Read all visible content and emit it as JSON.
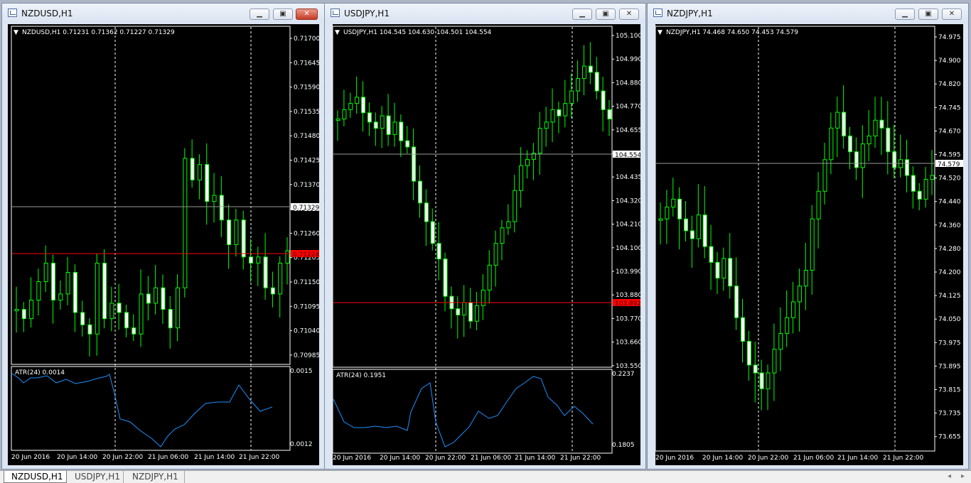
{
  "windows": [
    {
      "title": "NZDUSD,H1",
      "info": "NZDUSD,H1  0.71231 0.71362 0.71227 0.71329",
      "price_labels": [
        "0.71700",
        "0.71645",
        "0.71590",
        "0.71535",
        "0.71480",
        "0.71425",
        "0.71370",
        "0.71315",
        "0.71260",
        "0.71205",
        "0.71150",
        "0.71095",
        "0.71040",
        "0.70985"
      ],
      "current_price": "0.71329",
      "bid_line": "0.71224",
      "indicator": "ATR(24) 0.0014",
      "ind_top": "0.0015",
      "ind_bottom": "0.0012",
      "time_labels": [
        "20 Jun 2016",
        "20 Jun 14:00",
        "20 Jun 22:00",
        "21 Jun 06:00",
        "21 Jun 14:00",
        "21 Jun 22:00"
      ]
    },
    {
      "title": "USDJPY,H1",
      "info": "USDJPY,H1  104.545 104.630 104.501 104.554",
      "price_labels": [
        "105.100",
        "104.990",
        "104.880",
        "104.770",
        "104.655",
        "104.545",
        "104.435",
        "104.320",
        "104.210",
        "104.100",
        "103.990",
        "103.880",
        "103.770",
        "103.660",
        "103.550"
      ],
      "current_price": "104.554",
      "bid_line": "103.892",
      "indicator": "ATR(24) 0.1951",
      "ind_top": "0.2237",
      "ind_bottom": "0.1805",
      "time_labels": [
        "20 Jun 2016",
        "20 Jun 14:00",
        "20 Jun 22:00",
        "21 Jun 06:00",
        "21 Jun 14:00",
        "21 Jun 22:00"
      ]
    },
    {
      "title": "NZDJPY,H1",
      "info": "NZDJPY,H1  74.468 74.650 74.453 74.579",
      "price_labels": [
        "74.975",
        "74.900",
        "74.820",
        "74.745",
        "74.670",
        "74.595",
        "74.520",
        "74.440",
        "74.360",
        "74.280",
        "74.200",
        "74.125",
        "74.050",
        "73.975",
        "73.895",
        "73.815",
        "73.735",
        "73.655"
      ],
      "current_price": "74.579",
      "time_labels": [
        "20 Jun 2016",
        "20 Jun 14:00",
        "20 Jun 22:00",
        "21 Jun 06:00",
        "21 Jun 14:00",
        "21 Jun 22:00"
      ]
    }
  ],
  "tabs": [
    "NZDUSD,H1",
    "USDJPY,H1",
    "NZDJPY,H1"
  ],
  "colors": {
    "background": "#000000",
    "candle_up_body": "#000000",
    "candle_down_body": "#ffffff",
    "candle_wick": "#00ff00",
    "bid_line": "#ff0000",
    "grid_separator": "#ffffff",
    "atr_line": "#1e90ff"
  },
  "scroll_arrows": {
    "left": "◂",
    "right": "▸"
  }
}
